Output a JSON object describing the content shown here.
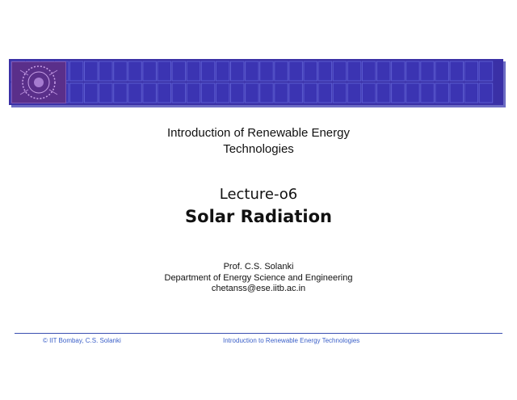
{
  "banner": {
    "logo_icon": "iit-bombay-emblem-icon",
    "color": "#3a30a6"
  },
  "slide": {
    "course_line1": "Introduction of Renewable Energy",
    "course_line2": "Technologies",
    "lecture": "Lecture-o6",
    "topic": "Solar Radiation",
    "author_name": "Prof. C.S. Solanki",
    "author_dept": "Department of Energy Science and Engineering",
    "author_email": "chetanss@ese.iitb.ac.in"
  },
  "footer": {
    "copyright": "© IIT Bombay, C.S. Solanki",
    "course": "Introduction to Renewable Energy Technologies"
  }
}
